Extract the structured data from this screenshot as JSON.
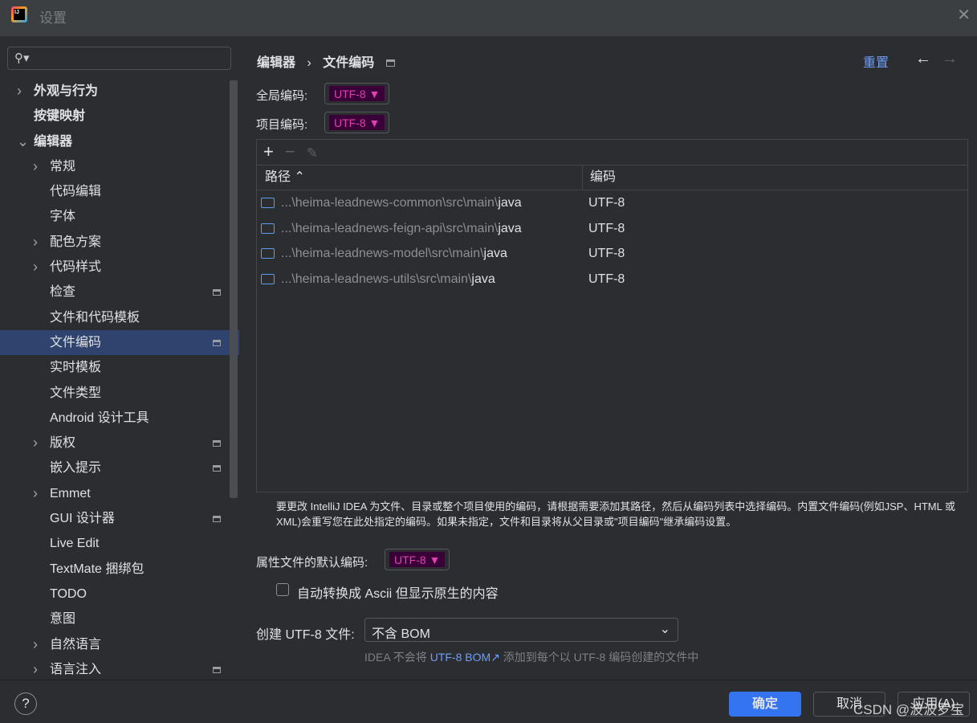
{
  "window": {
    "title": "设置",
    "app_icon": "IJ"
  },
  "search": {
    "placeholder": ""
  },
  "tree": [
    {
      "label": "外观与行为",
      "level": 0,
      "arrow": "collapsed",
      "bold": true
    },
    {
      "label": "按键映射",
      "level": 0,
      "arrow": "none",
      "bold": true
    },
    {
      "label": "编辑器",
      "level": 0,
      "arrow": "expanded",
      "bold": true
    },
    {
      "label": "常规",
      "level": 1,
      "arrow": "collapsed"
    },
    {
      "label": "代码编辑",
      "level": 1,
      "arrow": "none"
    },
    {
      "label": "字体",
      "level": 1,
      "arrow": "none"
    },
    {
      "label": "配色方案",
      "level": 1,
      "arrow": "collapsed"
    },
    {
      "label": "代码样式",
      "level": 1,
      "arrow": "collapsed"
    },
    {
      "label": "检查",
      "level": 1,
      "arrow": "none",
      "badge": true
    },
    {
      "label": "文件和代码模板",
      "level": 1,
      "arrow": "none"
    },
    {
      "label": "文件编码",
      "level": 1,
      "arrow": "none",
      "badge": true,
      "selected": true
    },
    {
      "label": "实时模板",
      "level": 1,
      "arrow": "none"
    },
    {
      "label": "文件类型",
      "level": 1,
      "arrow": "none"
    },
    {
      "label": "Android 设计工具",
      "level": 1,
      "arrow": "none"
    },
    {
      "label": "版权",
      "level": 1,
      "arrow": "collapsed",
      "badge": true
    },
    {
      "label": "嵌入提示",
      "level": 1,
      "arrow": "none",
      "badge": true
    },
    {
      "label": "Emmet",
      "level": 1,
      "arrow": "collapsed"
    },
    {
      "label": "GUI 设计器",
      "level": 1,
      "arrow": "none",
      "badge": true
    },
    {
      "label": "Live Edit",
      "level": 1,
      "arrow": "none"
    },
    {
      "label": "TextMate 捆绑包",
      "level": 1,
      "arrow": "none"
    },
    {
      "label": "TODO",
      "level": 1,
      "arrow": "none"
    },
    {
      "label": "意图",
      "level": 1,
      "arrow": "none"
    },
    {
      "label": "自然语言",
      "level": 1,
      "arrow": "collapsed"
    },
    {
      "label": "语言注入",
      "level": 1,
      "arrow": "collapsed",
      "badge": true
    }
  ],
  "breadcrumb": {
    "parent": "编辑器",
    "sep": "›",
    "current": "文件编码"
  },
  "header": {
    "reset": "重置"
  },
  "global_encoding": {
    "label": "全局编码:",
    "value": "UTF-8"
  },
  "project_encoding": {
    "label": "项目编码:",
    "value": "UTF-8"
  },
  "table": {
    "columns": [
      "路径",
      "编码"
    ],
    "sort_indicator": "^",
    "rows": [
      {
        "path_prefix": "...\\heima-leadnews-common\\src\\main\\",
        "path_leaf": "java",
        "encoding": "UTF-8"
      },
      {
        "path_prefix": "...\\heima-leadnews-feign-api\\src\\main\\",
        "path_leaf": "java",
        "encoding": "UTF-8"
      },
      {
        "path_prefix": "...\\heima-leadnews-model\\src\\main\\",
        "path_leaf": "java",
        "encoding": "UTF-8"
      },
      {
        "path_prefix": "...\\heima-leadnews-utils\\src\\main\\",
        "path_leaf": "java",
        "encoding": "UTF-8"
      }
    ]
  },
  "help_text": "要更改 IntelliJ IDEA 为文件、目录或整个项目使用的编码，请根据需要添加其路径，然后从编码列表中选择编码。内置文件编码(例如JSP、HTML 或 XML)会重写您在此处指定的编码。如果未指定，文件和目录将从父目录或\"项目编码\"继承编码设置。",
  "properties_encoding": {
    "label": "属性文件的默认编码:",
    "value": "UTF-8"
  },
  "native_ascii": {
    "label": "自动转换成 Ascii 但显示原生的内容",
    "checked": false
  },
  "bom": {
    "label": "创建 UTF-8 文件:",
    "value": "不含 BOM",
    "note_before": "IDEA 不会将",
    "note_link": "UTF-8 BOM↗",
    "note_after": "添加到每个以 UTF-8 编码创建的文件中"
  },
  "footer": {
    "help": "?",
    "ok": "确定",
    "cancel": "取消",
    "apply": "应用(A)"
  },
  "watermark": "CSDN @波波罗宝",
  "colors": {
    "accent": "#3574f0",
    "selection": "#2e436e",
    "link": "#6f9ef8",
    "encoding_highlight": "#3a0038"
  }
}
